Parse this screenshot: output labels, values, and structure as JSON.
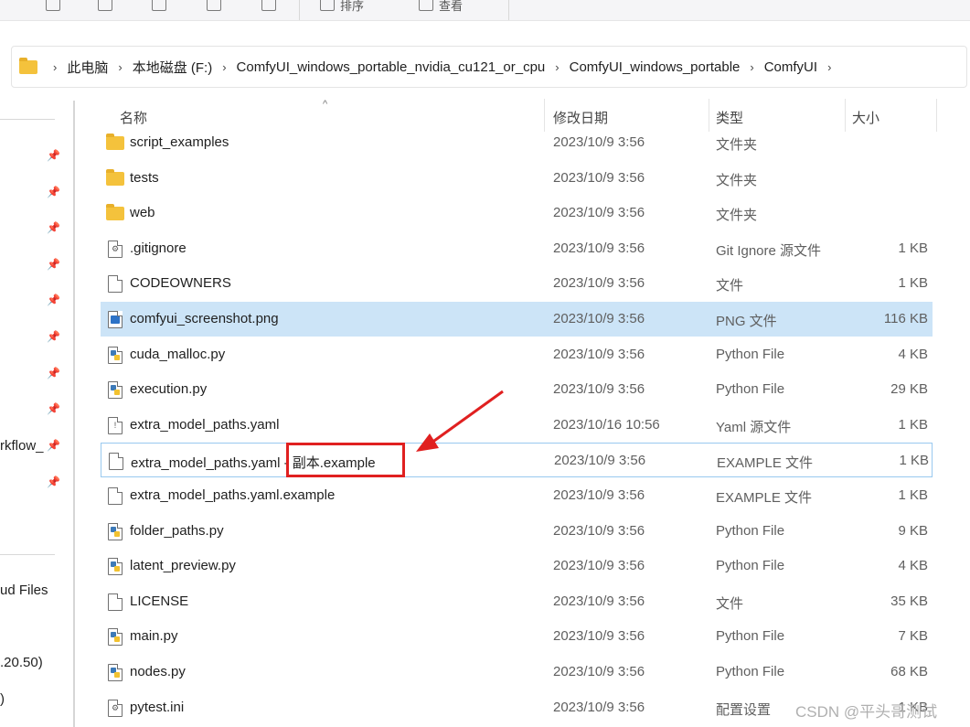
{
  "toolbar": {
    "sort_label": "排序",
    "view_label": "查看"
  },
  "address": {
    "crumbs": [
      "此电脑",
      "本地磁盘 (F:)",
      "ComfyUI_windows_portable_nvidia_cu121_or_cpu",
      "ComfyUI_windows_portable",
      "ComfyUI"
    ]
  },
  "nav": {
    "texts": [
      "rkflow_",
      "ud Files",
      ".20.50)",
      ")"
    ]
  },
  "columns": {
    "name": "名称",
    "date": "修改日期",
    "type": "类型",
    "size": "大小"
  },
  "files": [
    {
      "name": "script_examples",
      "date": "2023/10/9 3:56",
      "type": "文件夹",
      "size": "",
      "icon": "folder-icon"
    },
    {
      "name": "tests",
      "date": "2023/10/9 3:56",
      "type": "文件夹",
      "size": "",
      "icon": "folder-icon"
    },
    {
      "name": "web",
      "date": "2023/10/9 3:56",
      "type": "文件夹",
      "size": "",
      "icon": "folder-icon"
    },
    {
      "name": ".gitignore",
      "date": "2023/10/9 3:56",
      "type": "Git Ignore 源文件",
      "size": "1 KB",
      "icon": "settings-file-icon"
    },
    {
      "name": "CODEOWNERS",
      "date": "2023/10/9 3:56",
      "type": "文件",
      "size": "1 KB",
      "icon": "file-icon"
    },
    {
      "name": "comfyui_screenshot.png",
      "date": "2023/10/9 3:56",
      "type": "PNG 文件",
      "size": "116 KB",
      "icon": "image-file-icon"
    },
    {
      "name": "cuda_malloc.py",
      "date": "2023/10/9 3:56",
      "type": "Python File",
      "size": "4 KB",
      "icon": "python-file-icon"
    },
    {
      "name": "execution.py",
      "date": "2023/10/9 3:56",
      "type": "Python File",
      "size": "29 KB",
      "icon": "python-file-icon"
    },
    {
      "name": "extra_model_paths.yaml",
      "date": "2023/10/16 10:56",
      "type": "Yaml 源文件",
      "size": "1 KB",
      "icon": "yaml-file-icon"
    },
    {
      "name": "extra_model_paths.yaml - 副本.example",
      "date": "2023/10/9 3:56",
      "type": "EXAMPLE 文件",
      "size": "1 KB",
      "icon": "file-icon"
    },
    {
      "name": "extra_model_paths.yaml.example",
      "date": "2023/10/9 3:56",
      "type": "EXAMPLE 文件",
      "size": "1 KB",
      "icon": "file-icon"
    },
    {
      "name": "folder_paths.py",
      "date": "2023/10/9 3:56",
      "type": "Python File",
      "size": "9 KB",
      "icon": "python-file-icon"
    },
    {
      "name": "latent_preview.py",
      "date": "2023/10/9 3:56",
      "type": "Python File",
      "size": "4 KB",
      "icon": "python-file-icon"
    },
    {
      "name": "LICENSE",
      "date": "2023/10/9 3:56",
      "type": "文件",
      "size": "35 KB",
      "icon": "file-icon"
    },
    {
      "name": "main.py",
      "date": "2023/10/9 3:56",
      "type": "Python File",
      "size": "7 KB",
      "icon": "python-file-icon"
    },
    {
      "name": "nodes.py",
      "date": "2023/10/9 3:56",
      "type": "Python File",
      "size": "68 KB",
      "icon": "python-file-icon"
    },
    {
      "name": "pytest.ini",
      "date": "2023/10/9 3:56",
      "type": "配置设置",
      "size": "1 KB",
      "icon": "settings-file-icon"
    }
  ],
  "watermark": "CSDN @平头哥测试",
  "colors": {
    "selection": "#cce4f7",
    "focus_border": "#99c9ef",
    "annotation_red": "#e02020",
    "folder": "#f4c23c"
  }
}
